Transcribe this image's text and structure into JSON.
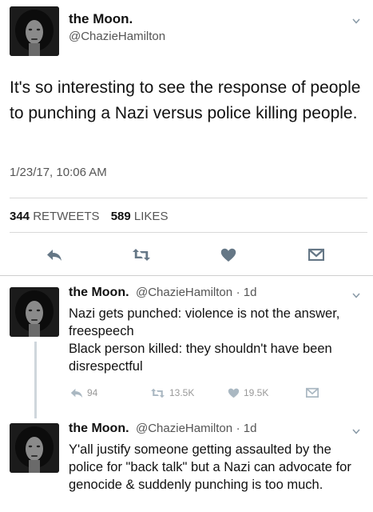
{
  "main_tweet": {
    "name": "the Moon.",
    "handle": "@ChazieHamilton",
    "text": "It's so interesting to see the response of people to punching a Nazi versus police killing people.",
    "timestamp": "1/23/17, 10:06 AM",
    "retweets_count": "344",
    "retweets_label": "RETWEETS",
    "likes_count": "589",
    "likes_label": "LIKES",
    "icons": {
      "reply": "reply-icon",
      "retweet": "retweet-icon",
      "like": "heart-icon",
      "dm": "envelope-icon",
      "more": "chevron-down-icon"
    }
  },
  "replies": [
    {
      "name": "the Moon.",
      "handle": "@ChazieHamilton",
      "age": "· 1d",
      "text_lines": [
        "Nazi gets punched: violence is not the answer, freespeech",
        "Black person killed: they shouldn't have been disrespectful"
      ],
      "reply_count": "94",
      "retweet_count": "13.5K",
      "like_count": "19.5K"
    },
    {
      "name": "the Moon.",
      "handle": "@ChazieHamilton",
      "age": "· 1d",
      "text_lines": [
        "Y'all justify someone getting assaulted by the police for \"back talk\" but a Nazi can advocate for genocide & suddenly punching is too much."
      ]
    }
  ],
  "colors": {
    "text": "#111111",
    "secondary": "#555555",
    "action_main": "#657786",
    "action_muted": "#aab8c2",
    "divider": "#d9d9d9"
  }
}
